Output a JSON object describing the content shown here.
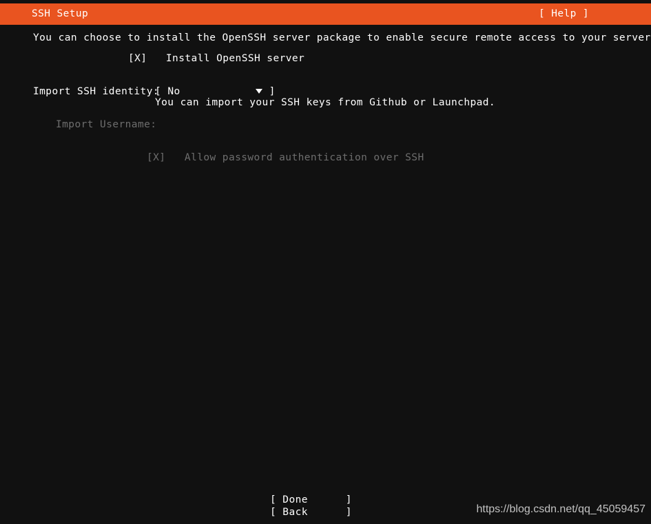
{
  "colors": {
    "accent": "#e95420",
    "background": "#111111",
    "foreground": "#ffffff",
    "disabled": "#6e6e6e"
  },
  "titlebar": {
    "title": "SSH Setup",
    "help_label": "[ Help ]"
  },
  "main": {
    "intro_text": "You can choose to install the OpenSSH server package to enable secure remote access to your server.",
    "install_openssh": {
      "checkbox": "[X]",
      "label": "Install OpenSSH server",
      "checked": true
    },
    "import_identity": {
      "label": "Import SSH identity:",
      "bracket_open": "[",
      "value": "No",
      "arrow_icon": "chevron-down-icon",
      "bracket_close": "]",
      "help_text": "You can import your SSH keys from Github or Launchpad."
    },
    "import_username": {
      "label": "Import Username:",
      "value": "",
      "disabled": true
    },
    "allow_password_auth": {
      "checkbox": "[X]",
      "label": "Allow password authentication over SSH",
      "checked": true,
      "disabled": true
    }
  },
  "footer": {
    "done_label": "[ Done      ]",
    "back_label": "[ Back      ]"
  },
  "watermark": {
    "text": "https://blog.csdn.net/qq_45059457"
  }
}
